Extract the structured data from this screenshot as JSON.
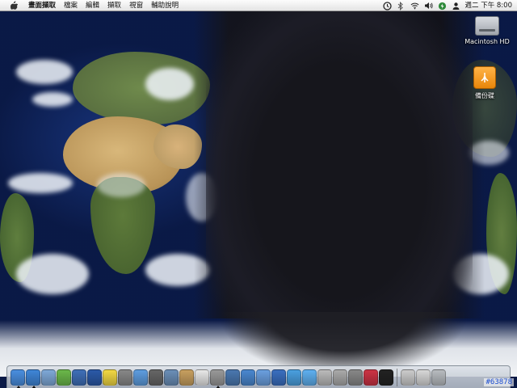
{
  "menubar": {
    "apple_icon": "apple-logo-icon",
    "items": [
      {
        "label": "畫面擷取",
        "bold": true
      },
      {
        "label": "檔案"
      },
      {
        "label": "編輯"
      },
      {
        "label": "擷取"
      },
      {
        "label": "視窗"
      },
      {
        "label": "輔助說明"
      }
    ],
    "status_icons": [
      "timemachine-icon",
      "bluetooth-icon",
      "wifi-icon",
      "volume-icon",
      "battery-charging-icon",
      "user-switch-icon"
    ],
    "clock": "週二 下午 8:00"
  },
  "desktop": {
    "icons": [
      {
        "label": "Macintosh HD",
        "icon": "hard-drive-icon"
      },
      {
        "label": "備份碟",
        "icon": "firewire-drive-icon"
      }
    ]
  },
  "dock": {
    "apps": [
      {
        "icon": "finder-icon",
        "color": "#4a8fe0",
        "running": true
      },
      {
        "icon": "safari-icon",
        "color": "#3f86d8",
        "running": true
      },
      {
        "icon": "mail-icon",
        "color": "#7fa9d8",
        "running": false
      },
      {
        "icon": "itunes-icon",
        "color": "#6bb84a",
        "running": false
      },
      {
        "icon": "imovie-icon",
        "color": "#3f6fb8",
        "running": false
      },
      {
        "icon": "clapper-icon",
        "color": "#2b5aa8",
        "running": false
      },
      {
        "icon": "stickies-icon",
        "color": "#f2d843",
        "running": false
      },
      {
        "icon": "magnifier-icon",
        "color": "#888888",
        "running": false
      },
      {
        "icon": "spotlight-icon",
        "color": "#5e9de0",
        "running": false
      },
      {
        "icon": "pen-icon",
        "color": "#666666",
        "running": false
      },
      {
        "icon": "preview-icon",
        "color": "#6b8fb8",
        "running": false
      },
      {
        "icon": "book-icon",
        "color": "#c8a060",
        "running": false
      },
      {
        "icon": "ical-icon",
        "color": "#e8e8e8",
        "running": false
      },
      {
        "icon": "tools-icon",
        "color": "#999999",
        "running": true
      },
      {
        "icon": "photo-icon",
        "color": "#4a78b0",
        "running": false
      },
      {
        "icon": "photobooth-icon",
        "color": "#4a88d0",
        "running": false
      },
      {
        "icon": "ichat-icon",
        "color": "#6ba0e0",
        "running": false
      },
      {
        "icon": "address-book-icon",
        "color": "#3a6fc0",
        "running": false
      },
      {
        "icon": "spaces-icon",
        "color": "#4aa0e0",
        "running": false
      },
      {
        "icon": "quicktime-icon",
        "color": "#5fb0f0",
        "running": false
      },
      {
        "icon": "system-profiler-icon",
        "color": "#bbbbbb",
        "running": false
      },
      {
        "icon": "utility-icon",
        "color": "#aaaaaa",
        "running": false
      },
      {
        "icon": "sync-icon",
        "color": "#888888",
        "running": false
      },
      {
        "icon": "shield-icon",
        "color": "#cc3344",
        "running": false
      },
      {
        "icon": "terminal-icon",
        "color": "#222222",
        "running": false
      }
    ],
    "trailing": [
      {
        "icon": "downloads-icon",
        "color": "#cccccc",
        "running": false
      },
      {
        "icon": "folder-stack-icon",
        "color": "#d8d8d8",
        "running": false
      },
      {
        "icon": "trash-icon",
        "color": "#b8bcc0",
        "running": false
      }
    ]
  },
  "watermark": "#63878"
}
